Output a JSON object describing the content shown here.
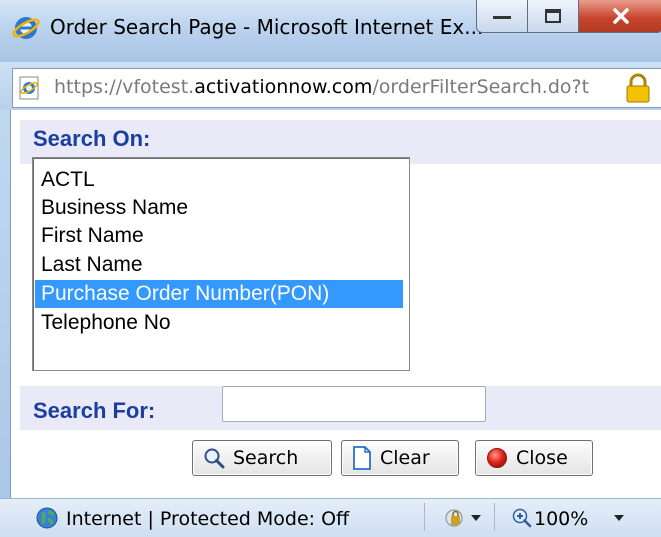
{
  "window": {
    "title": "Order Search Page - Microsoft Internet Ex...",
    "controls": {
      "minimize": "minimize",
      "maximize": "maximize",
      "close": "close"
    }
  },
  "address_bar": {
    "url_prefix": "https://vfotest.",
    "url_domain": "activationnow.com",
    "url_path": "/orderFilterSearch.do?t"
  },
  "form": {
    "search_on_label": "Search On:",
    "search_on_options": [
      "ACTL",
      "Business Name",
      "First Name",
      "Last Name",
      "Purchase Order Number(PON)",
      "Telephone No"
    ],
    "search_on_selected": "Purchase Order Number(PON)",
    "search_for_label": "Search For:",
    "search_for_value": ""
  },
  "buttons": {
    "search": "Search",
    "clear": "Clear",
    "close": "Close"
  },
  "status_bar": {
    "zone_text": "Internet | Protected Mode: Off",
    "zoom": "100%"
  },
  "colors": {
    "label_blue": "#1a3fa0",
    "header_row_bg": "#e9e9f7",
    "selection": "#3399ff"
  }
}
